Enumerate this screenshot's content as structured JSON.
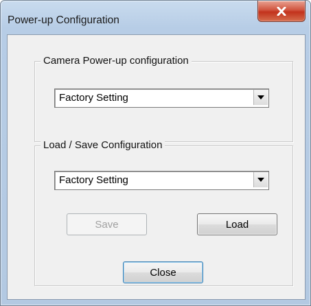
{
  "window": {
    "title": "Power-up Configuration",
    "close_icon": "close-x-icon",
    "close_color": "#c2321c"
  },
  "camera_group": {
    "legend": "Camera Power-up configuration",
    "combo_value": "Factory Setting"
  },
  "load_save_group": {
    "legend": "Load / Save Configuration",
    "combo_value": "Factory Setting",
    "save_label": "Save",
    "save_enabled": false,
    "load_label": "Load"
  },
  "footer": {
    "close_label": "Close"
  }
}
